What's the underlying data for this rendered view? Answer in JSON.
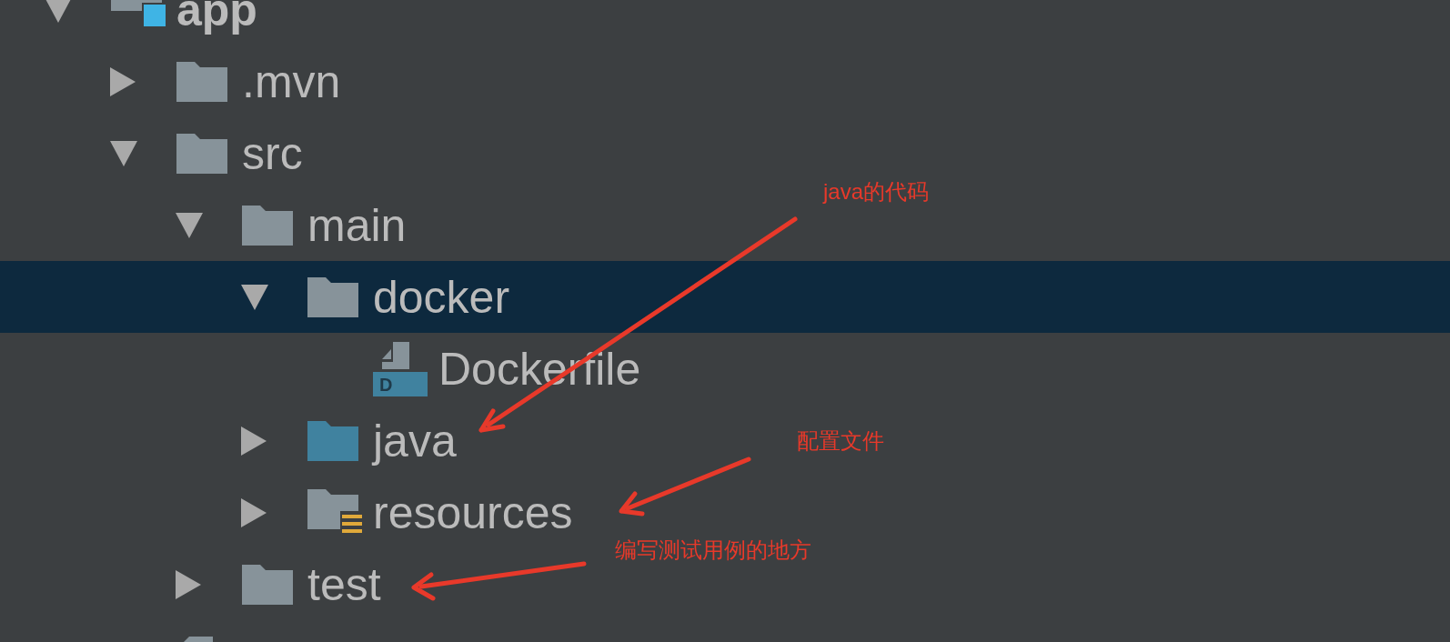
{
  "tree": [
    {
      "kind": "module",
      "name": "app",
      "expanded": true,
      "selected": false,
      "children": [
        {
          "kind": "folder",
          "name": ".mvn",
          "expanded": false,
          "selected": false
        },
        {
          "kind": "folder",
          "name": "src",
          "expanded": true,
          "selected": false,
          "children": [
            {
              "kind": "folder",
              "name": "main",
              "expanded": true,
              "selected": false,
              "children": [
                {
                  "kind": "folder",
                  "name": "docker",
                  "expanded": true,
                  "selected": true,
                  "children": [
                    {
                      "kind": "dockerfile",
                      "name": "Dockerfile",
                      "icon_letter": "D",
                      "selected": false
                    }
                  ]
                },
                {
                  "kind": "source_folder",
                  "name": "java",
                  "expanded": false,
                  "selected": false
                },
                {
                  "kind": "resource_folder",
                  "name": "resources",
                  "expanded": false,
                  "selected": false
                }
              ]
            },
            {
              "kind": "folder",
              "name": "test",
              "expanded": false,
              "selected": false
            }
          ]
        },
        {
          "kind": "file_cut",
          "selected": false
        }
      ]
    }
  ],
  "annotations": [
    {
      "text": "java的代码"
    },
    {
      "text": "配置文件"
    },
    {
      "text": "编写测试用例的地方"
    }
  ]
}
